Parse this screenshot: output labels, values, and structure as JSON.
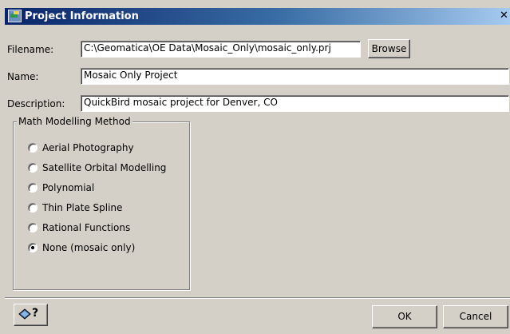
{
  "window": {
    "title": "Project Information"
  },
  "form": {
    "filename_label": "Filename:",
    "filename_value": "C:\\Geomatica\\OE Data\\Mosaic_Only\\mosaic_only.prj",
    "browse_label": "Browse",
    "name_label": "Name:",
    "name_value": "Mosaic Only Project",
    "description_label": "Description:",
    "description_value": "QuickBird mosaic project for Denver, CO"
  },
  "math_method": {
    "group_label": "Math Modelling Method",
    "options": [
      {
        "label": "Aerial Photography",
        "selected": false
      },
      {
        "label": "Satellite Orbital Modelling",
        "selected": false
      },
      {
        "label": "Polynomial",
        "selected": false
      },
      {
        "label": "Thin Plate Spline",
        "selected": false
      },
      {
        "label": "Rational Functions",
        "selected": false
      },
      {
        "label": "None (mosaic only)",
        "selected": true
      }
    ]
  },
  "footer": {
    "help_icon": "context-help-icon",
    "help_glyph": "?",
    "ok_label": "OK",
    "cancel_label": "Cancel"
  },
  "colors": {
    "dialog_bg": "#d4d0c8",
    "titlebar_start": "#0a246a",
    "titlebar_end": "#a6caf0"
  }
}
